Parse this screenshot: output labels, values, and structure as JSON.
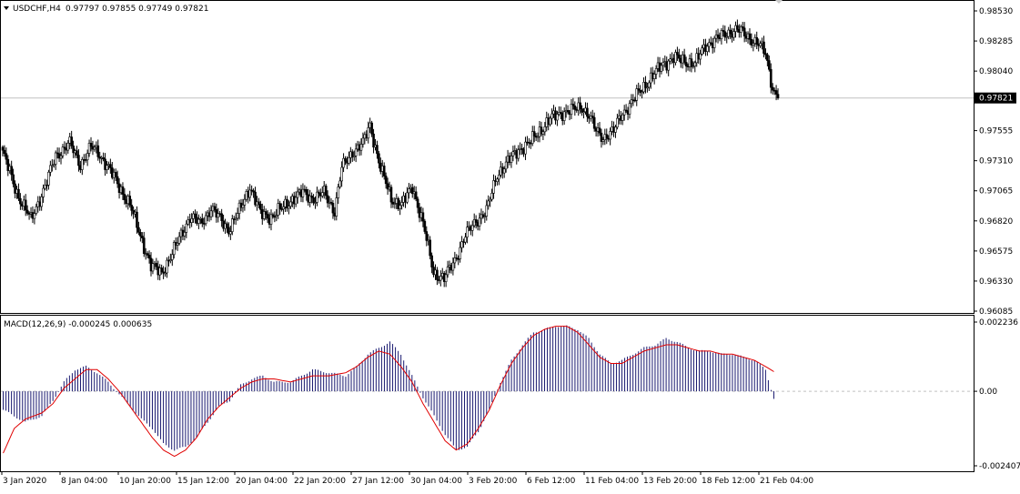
{
  "header": {
    "symbol_label": "USDCHF,H4",
    "ohlc": "0.97797 0.97855 0.97749 0.97821",
    "menu_icon": "triangle-down-icon"
  },
  "macd_header": {
    "label": "MACD(12,26,9) -0.000245 0.000635"
  },
  "colors": {
    "candle_bull": "#ffffff",
    "candle_bear": "#000000",
    "candle_outline": "#000000",
    "macd_histogram": "#191970",
    "macd_signal": "#e00000",
    "price_line": "#c0c0c0",
    "zero_line": "#c0c0c0",
    "price_tag_bg": "#000000",
    "price_tag_text": "#ffffff"
  },
  "chart_data": [
    {
      "type": "candlestick",
      "title": "USDCHF,H4",
      "ylim": [
        0.96085,
        0.9853
      ],
      "y_ticks": [
        "0.98530",
        "0.98285",
        "0.98040",
        "0.97800",
        "0.97555",
        "0.97310",
        "0.97065",
        "0.96820",
        "0.96575",
        "0.96330",
        "0.96085"
      ],
      "current_price": "0.97821",
      "grid": false,
      "close_waypoints": [
        [
          0,
          0.9738
        ],
        [
          8,
          0.9705
        ],
        [
          16,
          0.9683
        ],
        [
          24,
          0.971
        ],
        [
          30,
          0.9735
        ],
        [
          38,
          0.9745
        ],
        [
          44,
          0.9728
        ],
        [
          50,
          0.9742
        ],
        [
          54,
          0.9738
        ],
        [
          60,
          0.9725
        ],
        [
          66,
          0.971
        ],
        [
          72,
          0.9695
        ],
        [
          78,
          0.967
        ],
        [
          84,
          0.9645
        ],
        [
          90,
          0.964
        ],
        [
          96,
          0.9655
        ],
        [
          100,
          0.9668
        ],
        [
          106,
          0.9685
        ],
        [
          112,
          0.968
        ],
        [
          118,
          0.9692
        ],
        [
          124,
          0.9682
        ],
        [
          128,
          0.9675
        ],
        [
          134,
          0.969
        ],
        [
          140,
          0.971
        ],
        [
          146,
          0.9688
        ],
        [
          152,
          0.9685
        ],
        [
          158,
          0.9692
        ],
        [
          164,
          0.97
        ],
        [
          170,
          0.9705
        ],
        [
          176,
          0.97
        ],
        [
          182,
          0.9705
        ],
        [
          188,
          0.969
        ],
        [
          192,
          0.9725
        ],
        [
          198,
          0.9738
        ],
        [
          204,
          0.9745
        ],
        [
          208,
          0.976
        ],
        [
          214,
          0.9725
        ],
        [
          220,
          0.97
        ],
        [
          226,
          0.9695
        ],
        [
          232,
          0.971
        ],
        [
          238,
          0.968
        ],
        [
          244,
          0.964
        ],
        [
          250,
          0.9635
        ],
        [
          256,
          0.965
        ],
        [
          262,
          0.967
        ],
        [
          268,
          0.9682
        ],
        [
          274,
          0.969
        ],
        [
          280,
          0.972
        ],
        [
          286,
          0.973
        ],
        [
          292,
          0.974
        ],
        [
          298,
          0.9745
        ],
        [
          304,
          0.9755
        ],
        [
          310,
          0.9765
        ],
        [
          316,
          0.977
        ],
        [
          322,
          0.9772
        ],
        [
          328,
          0.9775
        ],
        [
          332,
          0.9768
        ],
        [
          336,
          0.9755
        ],
        [
          340,
          0.975
        ],
        [
          346,
          0.9755
        ],
        [
          350,
          0.9768
        ],
        [
          356,
          0.9778
        ],
        [
          362,
          0.979
        ],
        [
          368,
          0.98
        ],
        [
          374,
          0.981
        ],
        [
          380,
          0.9815
        ],
        [
          386,
          0.9812
        ],
        [
          392,
          0.981
        ],
        [
          398,
          0.9825
        ],
        [
          404,
          0.983
        ],
        [
          410,
          0.9835
        ],
        [
          416,
          0.9838
        ],
        [
          422,
          0.9832
        ],
        [
          428,
          0.9826
        ],
        [
          432,
          0.9818
        ],
        [
          436,
          0.979
        ],
        [
          439,
          0.97821
        ]
      ]
    },
    {
      "type": "macd",
      "title": "MACD(12,26,9) -0.000245 0.000635",
      "ylim": [
        -0.002407,
        0.002236
      ],
      "y_ticks": [
        "0.002236",
        "0.00",
        "-0.002407"
      ],
      "main_value": -0.000245,
      "signal_value": 0.000635,
      "main_waypoints": [
        [
          0,
          -0.0006
        ],
        [
          4,
          -0.0008
        ],
        [
          8,
          -0.001
        ],
        [
          14,
          -0.0008
        ],
        [
          18,
          -0.0003
        ],
        [
          22,
          0.0003
        ],
        [
          26,
          0.0007
        ],
        [
          30,
          0.0008
        ],
        [
          34,
          0.0006
        ],
        [
          38,
          0.0003
        ],
        [
          42,
          -0.0001
        ],
        [
          46,
          -0.0005
        ],
        [
          50,
          -0.0009
        ],
        [
          54,
          -0.0012
        ],
        [
          58,
          -0.0017
        ],
        [
          62,
          -0.0019
        ],
        [
          66,
          -0.0018
        ],
        [
          70,
          -0.0015
        ],
        [
          74,
          -0.001
        ],
        [
          78,
          -0.0005
        ],
        [
          82,
          -0.0003
        ],
        [
          86,
          0.0002
        ],
        [
          90,
          0.0004
        ],
        [
          94,
          0.0005
        ],
        [
          98,
          0.0003
        ],
        [
          104,
          0.0003
        ],
        [
          108,
          0.0005
        ],
        [
          112,
          0.0007
        ],
        [
          118,
          0.0006
        ],
        [
          124,
          0.0005
        ],
        [
          128,
          0.0008
        ],
        [
          132,
          0.0012
        ],
        [
          136,
          0.0014
        ],
        [
          140,
          0.0016
        ],
        [
          144,
          0.0012
        ],
        [
          148,
          0.0005
        ],
        [
          152,
          -0.0002
        ],
        [
          156,
          -0.0008
        ],
        [
          160,
          -0.0014
        ],
        [
          164,
          -0.0019
        ],
        [
          168,
          -0.0018
        ],
        [
          172,
          -0.0013
        ],
        [
          176,
          -0.0006
        ],
        [
          180,
          0.0003
        ],
        [
          184,
          0.001
        ],
        [
          188,
          0.0015
        ],
        [
          192,
          0.0019
        ],
        [
          196,
          0.002
        ],
        [
          200,
          0.0021
        ],
        [
          204,
          0.0021
        ],
        [
          208,
          0.002
        ],
        [
          212,
          0.0017
        ],
        [
          216,
          0.0012
        ],
        [
          220,
          0.0009
        ],
        [
          224,
          0.001
        ],
        [
          228,
          0.0012
        ],
        [
          232,
          0.0014
        ],
        [
          236,
          0.0015
        ],
        [
          240,
          0.0017
        ],
        [
          244,
          0.0016
        ],
        [
          248,
          0.0014
        ],
        [
          252,
          0.0013
        ],
        [
          256,
          0.0013
        ],
        [
          260,
          0.0012
        ],
        [
          264,
          0.0012
        ],
        [
          268,
          0.0011
        ],
        [
          272,
          0.001
        ],
        [
          276,
          0.0007
        ],
        [
          279,
          -0.000245
        ]
      ],
      "signal_waypoints": [
        [
          0,
          -0.002
        ],
        [
          4,
          -0.0012
        ],
        [
          8,
          -0.0009
        ],
        [
          14,
          -0.0007
        ],
        [
          18,
          -0.0004
        ],
        [
          22,
          0.0001
        ],
        [
          26,
          0.0004
        ],
        [
          30,
          0.0007
        ],
        [
          34,
          0.0007
        ],
        [
          38,
          0.0004
        ],
        [
          42,
          0.0
        ],
        [
          46,
          -0.0005
        ],
        [
          50,
          -0.001
        ],
        [
          54,
          -0.0015
        ],
        [
          58,
          -0.0019
        ],
        [
          62,
          -0.0021
        ],
        [
          66,
          -0.0019
        ],
        [
          70,
          -0.0015
        ],
        [
          74,
          -0.0009
        ],
        [
          78,
          -0.0005
        ],
        [
          82,
          -0.0002
        ],
        [
          86,
          0.0001
        ],
        [
          90,
          0.0003
        ],
        [
          94,
          0.0004
        ],
        [
          98,
          0.0004
        ],
        [
          104,
          0.0003
        ],
        [
          108,
          0.0004
        ],
        [
          112,
          0.0005
        ],
        [
          118,
          0.0005
        ],
        [
          124,
          0.0006
        ],
        [
          128,
          0.0008
        ],
        [
          132,
          0.0011
        ],
        [
          136,
          0.0013
        ],
        [
          140,
          0.0012
        ],
        [
          144,
          0.0008
        ],
        [
          148,
          0.0003
        ],
        [
          152,
          -0.0004
        ],
        [
          156,
          -0.001
        ],
        [
          160,
          -0.0016
        ],
        [
          164,
          -0.0019
        ],
        [
          168,
          -0.0017
        ],
        [
          172,
          -0.0012
        ],
        [
          176,
          -0.0006
        ],
        [
          180,
          0.0002
        ],
        [
          184,
          0.0009
        ],
        [
          188,
          0.0014
        ],
        [
          192,
          0.0018
        ],
        [
          196,
          0.002
        ],
        [
          200,
          0.0021
        ],
        [
          204,
          0.0021
        ],
        [
          208,
          0.0019
        ],
        [
          212,
          0.0015
        ],
        [
          216,
          0.0011
        ],
        [
          220,
          0.0009
        ],
        [
          224,
          0.0009
        ],
        [
          228,
          0.0011
        ],
        [
          232,
          0.0013
        ],
        [
          236,
          0.0014
        ],
        [
          240,
          0.0015
        ],
        [
          244,
          0.0015
        ],
        [
          248,
          0.0014
        ],
        [
          252,
          0.0013
        ],
        [
          256,
          0.0013
        ],
        [
          260,
          0.0012
        ],
        [
          264,
          0.0012
        ],
        [
          268,
          0.0011
        ],
        [
          272,
          0.001
        ],
        [
          276,
          0.0008
        ],
        [
          279,
          0.000635
        ]
      ]
    }
  ],
  "x_axis": {
    "labels": [
      "3 Jan 2020",
      "8 Jan 04:00",
      "10 Jan 20:00",
      "15 Jan 12:00",
      "20 Jan 04:00",
      "22 Jan 20:00",
      "27 Jan 12:00",
      "30 Jan 04:00",
      "3 Feb 20:00",
      "6 Feb 12:00",
      "11 Feb 04:00",
      "13 Feb 20:00",
      "18 Feb 12:00",
      "21 Feb 04:00"
    ]
  }
}
